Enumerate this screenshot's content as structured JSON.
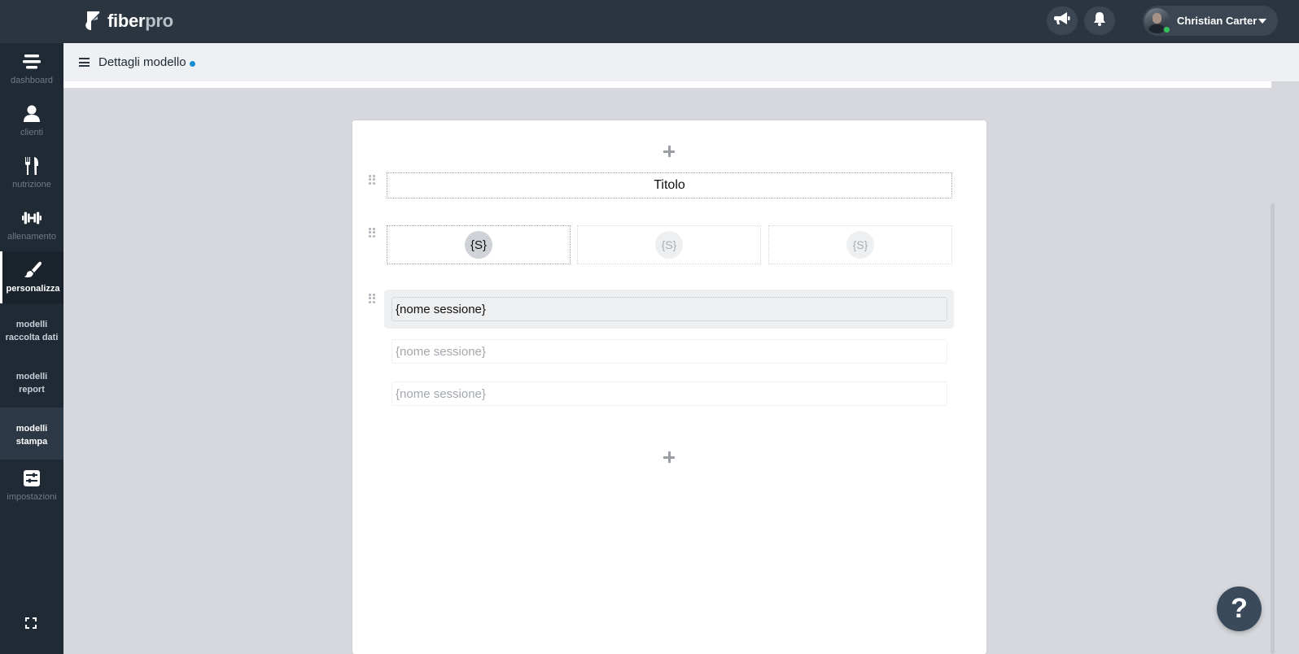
{
  "brand": {
    "name_part1": "fiber",
    "name_part2": "pro",
    "logo_icon": "fiberpro-logo-icon"
  },
  "topbar": {
    "announcements_icon": "megaphone-icon",
    "notifications_icon": "bell-icon",
    "user": {
      "name": "Christian Carter",
      "status": "online",
      "avatar_icon": "avatar",
      "caret_icon": "caret-down-icon"
    }
  },
  "sidebar": {
    "items": [
      {
        "id": "dashboard",
        "label": "dashboard",
        "icon": "dashboard-icon"
      },
      {
        "id": "clienti",
        "label": "clienti",
        "icon": "user-icon"
      },
      {
        "id": "nutrizione",
        "label": "nutrizione",
        "icon": "fork-knife-icon"
      },
      {
        "id": "allenamento",
        "label": "allenamento",
        "icon": "dumbbell-icon"
      },
      {
        "id": "personalizza",
        "label": "personalizza",
        "icon": "brush-icon",
        "active": true
      },
      {
        "id": "modelli-raccolta-dati",
        "line1": "modelli",
        "line2": "raccolta dati"
      },
      {
        "id": "modelli-report",
        "line1": "modelli",
        "line2": "report"
      },
      {
        "id": "modelli-stampa",
        "line1": "modelli",
        "line2": "stampa",
        "current": true
      },
      {
        "id": "impostazioni",
        "label": "impostazioni",
        "icon": "sliders-icon"
      }
    ],
    "fullscreen_icon": "expand-icon"
  },
  "header": {
    "title": "Dettagli modello",
    "unsaved_indicator_color": "#1a8fd0",
    "menu_icon": "hamburger-icon"
  },
  "editor": {
    "title_block": "Titolo",
    "s_cells": [
      "{S}",
      "{S}",
      "{S}"
    ],
    "sessions": [
      "{nome sessione}",
      "{nome sessione}",
      "{nome sessione}"
    ],
    "add_icon": "plus-icon",
    "drag_icon": "drag-handle-icon"
  },
  "help": {
    "label": "?"
  },
  "colors": {
    "topbar": "#2b3540",
    "sidebar": "#1f2a34",
    "accent": "#1a8fd0",
    "online": "#37c15a"
  }
}
